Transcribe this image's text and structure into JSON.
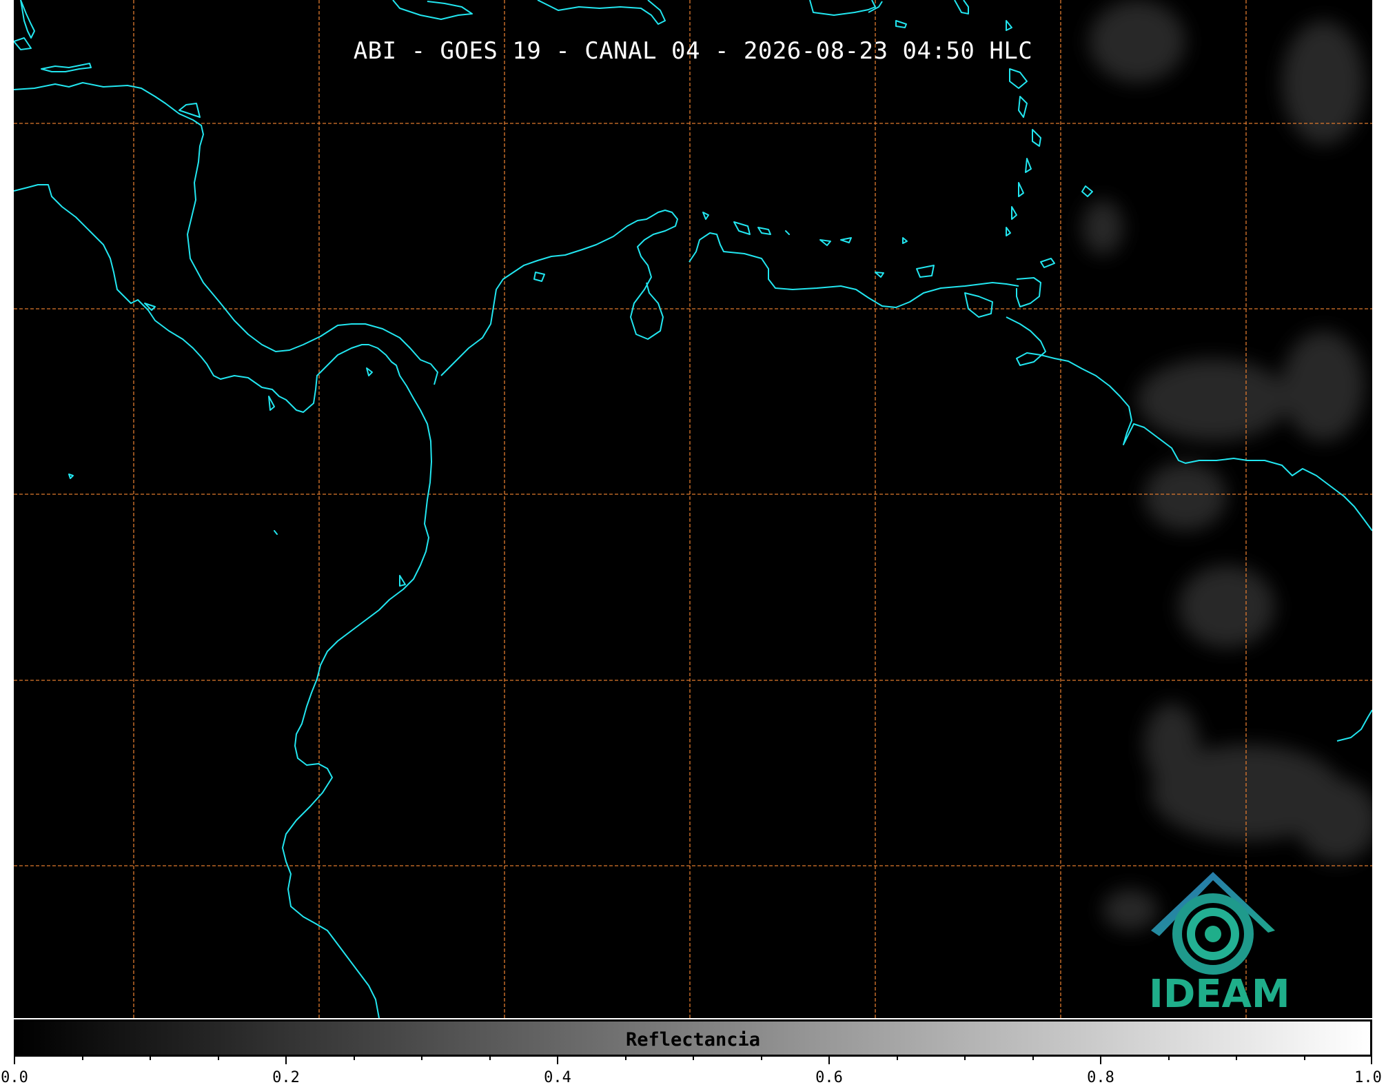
{
  "map": {
    "title": "ABI - GOES 19 - CANAL 04 - 2026-08-23 04:50 HLC",
    "coastline_color": "#22e6f0",
    "grid_color": "#e07a2e",
    "background": "#000000"
  },
  "logo": {
    "text": "IDEAM",
    "icon": "ideam-logo-icon"
  },
  "colorbar": {
    "label": "Reflectancia",
    "range": [
      0.0,
      1.0
    ],
    "tick_labels": [
      "0.0",
      "0.2",
      "0.4",
      "0.6",
      "0.8",
      "1.0"
    ]
  }
}
